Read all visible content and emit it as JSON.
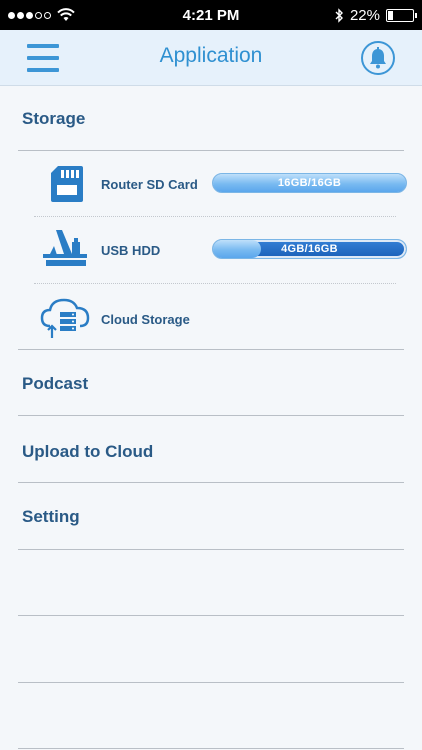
{
  "status_bar": {
    "time": "4:21 PM",
    "battery_text": "22%",
    "battery_level": 0.22,
    "signal_bars_total": 5,
    "signal_bars_filled": 3
  },
  "header": {
    "title": "Application"
  },
  "storage": {
    "label": "Storage",
    "items": [
      {
        "label": "Router SD Card",
        "usage": "16GB/16GB",
        "fraction": 1.0
      },
      {
        "label": "USB HDD",
        "usage": "4GB/16GB",
        "fraction": 0.25
      },
      {
        "label": "Cloud Storage"
      }
    ]
  },
  "menu": {
    "podcast": "Podcast",
    "upload": "Upload to Cloud",
    "setting": "Setting"
  },
  "colors": {
    "accent": "#3d96d6",
    "text": "#2a5a86",
    "header_bg": "#e6f1fb"
  }
}
